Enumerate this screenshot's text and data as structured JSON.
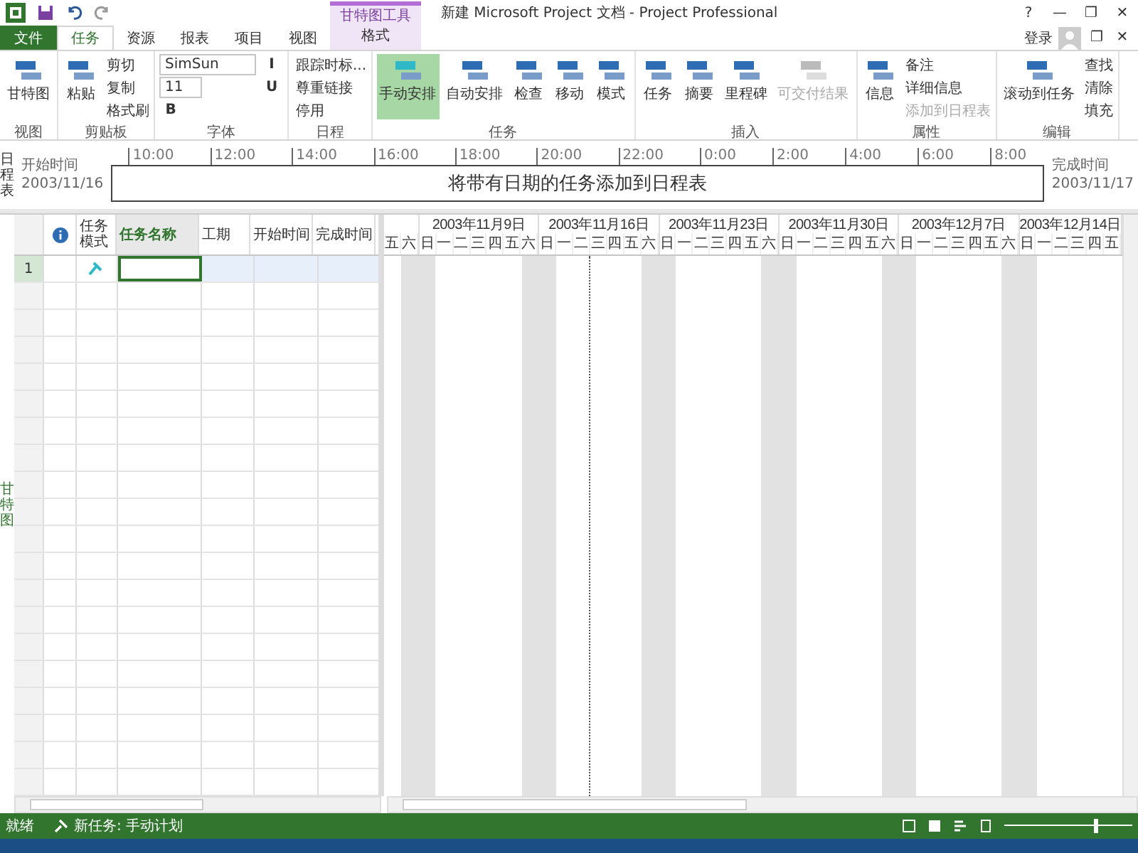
{
  "window": {
    "title": "新建 Microsoft Project 文档 - Project Professional",
    "controls": [
      "?",
      "—",
      "❐",
      "✕"
    ],
    "account": "登录",
    "doc_controls": [
      "❐",
      "✕"
    ]
  },
  "tabs": [
    {
      "label": "文件",
      "kind": "file",
      "selected": false
    },
    {
      "label": "任务",
      "kind": "tab",
      "selected": true
    },
    {
      "label": "资源",
      "kind": "tab",
      "selected": false
    },
    {
      "label": "报表",
      "kind": "tab",
      "selected": false
    },
    {
      "label": "项目",
      "kind": "tab",
      "selected": false
    },
    {
      "label": "视图",
      "kind": "tab",
      "selected": false
    },
    {
      "label": "格式",
      "kind": "context",
      "group": "甘特图工具",
      "selected": false
    }
  ],
  "ribbon": [
    {
      "name": "视图",
      "items": [
        {
          "label": "甘特图",
          "kind": "large",
          "selected": false,
          "disabled": false
        }
      ]
    },
    {
      "name": "剪贴板",
      "items": [
        {
          "label": "粘贴",
          "kind": "large",
          "selected": false,
          "disabled": false
        },
        {
          "label": "剪切",
          "kind": "small",
          "selected": false,
          "disabled": false
        },
        {
          "label": "复制",
          "kind": "small",
          "selected": false,
          "disabled": false
        },
        {
          "label": "格式刷",
          "kind": "small",
          "selected": false,
          "disabled": false
        }
      ]
    },
    {
      "name": "字体",
      "items": [
        {
          "label": "SimSun",
          "kind": "font"
        },
        {
          "label": "11",
          "kind": "size"
        },
        {
          "label": "B",
          "kind": "format",
          "selected": false
        },
        {
          "label": "I",
          "kind": "format",
          "selected": false
        },
        {
          "label": "U",
          "kind": "format",
          "selected": false
        }
      ]
    },
    {
      "name": "日程",
      "items": [
        {
          "label": "跟踪时标...",
          "kind": "small",
          "selected": false,
          "disabled": false
        },
        {
          "label": "尊重链接",
          "kind": "small",
          "selected": false,
          "disabled": false
        },
        {
          "label": "停用",
          "kind": "small",
          "selected": false,
          "disabled": false
        }
      ]
    },
    {
      "name": "任务",
      "items": [
        {
          "label": "手动安排",
          "kind": "large",
          "selected": true,
          "disabled": false
        },
        {
          "label": "自动安排",
          "kind": "large",
          "selected": false,
          "disabled": false
        },
        {
          "label": "检查",
          "kind": "large",
          "selected": false,
          "disabled": false
        },
        {
          "label": "移动",
          "kind": "large",
          "selected": false,
          "disabled": false
        },
        {
          "label": "模式",
          "kind": "large",
          "selected": false,
          "disabled": false
        }
      ]
    },
    {
      "name": "插入",
      "items": [
        {
          "label": "任务",
          "kind": "large",
          "selected": false,
          "disabled": false
        },
        {
          "label": "摘要",
          "kind": "large",
          "selected": false,
          "disabled": false
        },
        {
          "label": "里程碑",
          "kind": "large",
          "selected": false,
          "disabled": false
        },
        {
          "label": "可交付结果",
          "kind": "large",
          "selected": false,
          "disabled": true
        }
      ]
    },
    {
      "name": "属性",
      "items": [
        {
          "label": "信息",
          "kind": "large",
          "selected": false,
          "disabled": false
        },
        {
          "label": "备注",
          "kind": "small",
          "selected": false,
          "disabled": false
        },
        {
          "label": "详细信息",
          "kind": "small",
          "selected": false,
          "disabled": false
        },
        {
          "label": "添加到日程表",
          "kind": "small",
          "selected": false,
          "disabled": true
        }
      ]
    },
    {
      "name": "编辑",
      "items": [
        {
          "label": "滚动到任务",
          "kind": "large",
          "selected": false,
          "disabled": false
        },
        {
          "label": "查找",
          "kind": "small",
          "selected": false,
          "disabled": false
        },
        {
          "label": "清除",
          "kind": "small",
          "selected": false,
          "disabled": false
        },
        {
          "label": "填充",
          "kind": "small",
          "selected": false,
          "disabled": false
        }
      ]
    }
  ],
  "timeline": {
    "side_label": "日程表",
    "start_label": "开始时间",
    "start_date": "2003/11/16",
    "finish_label": "完成时间",
    "finish_date": "2003/11/17",
    "placeholder": "将带有日期的任务添加到日程表",
    "ticks": [
      "10:00",
      "12:00",
      "14:00",
      "16:00",
      "18:00",
      "20:00",
      "22:00",
      "0:00",
      "2:00",
      "4:00",
      "6:00",
      "8:00"
    ]
  },
  "view_label": "甘特图",
  "table": {
    "columns": [
      "任务模式",
      "任务名称",
      "工期",
      "开始时间",
      "完成时间"
    ],
    "rows": [
      {
        "id": "1",
        "selected": true
      }
    ]
  },
  "gantt": {
    "weeks": [
      {
        "days": [
          {
            "label": "五",
            "weekend": false
          },
          {
            "label": "六",
            "weekend": true
          }
        ]
      },
      {
        "label": "2003年11月9日",
        "days": [
          {
            "label": "日",
            "weekend": true
          },
          {
            "label": "一",
            "weekend": false
          },
          {
            "label": "二",
            "weekend": false
          },
          {
            "label": "三",
            "weekend": false
          },
          {
            "label": "四",
            "weekend": false
          },
          {
            "label": "五",
            "weekend": false
          },
          {
            "label": "六",
            "weekend": true
          }
        ]
      },
      {
        "label": "2003年11月16日",
        "days": [
          {
            "label": "日",
            "weekend": true
          },
          {
            "label": "一",
            "weekend": false
          },
          {
            "label": "二",
            "weekend": false
          },
          {
            "label": "三",
            "weekend": false
          },
          {
            "label": "四",
            "weekend": false
          },
          {
            "label": "五",
            "weekend": false
          },
          {
            "label": "六",
            "weekend": true
          }
        ]
      },
      {
        "label": "2003年11月23日",
        "days": [
          {
            "label": "日",
            "weekend": true
          },
          {
            "label": "一",
            "weekend": false
          },
          {
            "label": "二",
            "weekend": false
          },
          {
            "label": "三",
            "weekend": false
          },
          {
            "label": "四",
            "weekend": false
          },
          {
            "label": "五",
            "weekend": false
          },
          {
            "label": "六",
            "weekend": true
          }
        ]
      },
      {
        "label": "2003年11月30日",
        "days": [
          {
            "label": "日",
            "weekend": true
          },
          {
            "label": "一",
            "weekend": false
          },
          {
            "label": "二",
            "weekend": false
          },
          {
            "label": "三",
            "weekend": false
          },
          {
            "label": "四",
            "weekend": false
          },
          {
            "label": "五",
            "weekend": false
          },
          {
            "label": "六",
            "weekend": true
          }
        ]
      },
      {
        "label": "2003年12月7日",
        "days": [
          {
            "label": "日",
            "weekend": true
          },
          {
            "label": "一",
            "weekend": false
          },
          {
            "label": "二",
            "weekend": false
          },
          {
            "label": "三",
            "weekend": false
          },
          {
            "label": "四",
            "weekend": false
          },
          {
            "label": "五",
            "weekend": false
          },
          {
            "label": "六",
            "weekend": true
          }
        ]
      },
      {
        "label": "2003年12月14日",
        "days": [
          {
            "label": "日",
            "weekend": true
          },
          {
            "label": "一",
            "weekend": false
          },
          {
            "label": "二",
            "weekend": false
          },
          {
            "label": "三",
            "weekend": false
          },
          {
            "label": "四",
            "weekend": false
          },
          {
            "label": "五",
            "weekend": false
          }
        ]
      }
    ]
  },
  "status_bar": {
    "ready": "就绪",
    "new_task": "新任务: 手动计划",
    "zoom": {
      "level": 0.7
    }
  }
}
